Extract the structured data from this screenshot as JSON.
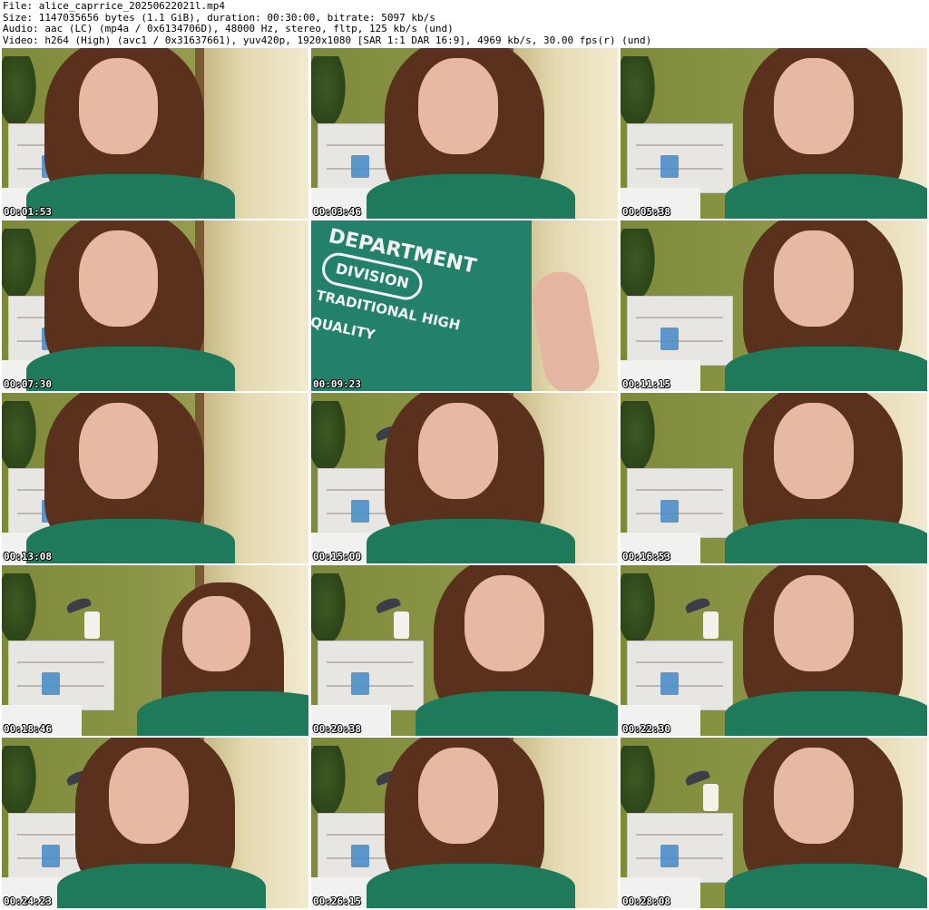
{
  "header": {
    "file": "File: alice_caprrice_20250622021l.mp4",
    "size": "Size: 1147035656 bytes (1.1 GiB), duration: 00:30:00, bitrate: 5097 kb/s",
    "audio": "Audio: aac (LC) (mp4a / 0x6134706D), 48000 Hz, stereo, fltp, 125 kb/s (und)",
    "video": "Video: h264 (High) (avc1 / 0x31637661), yuv420p, 1920x1080 [SAR 1:1 DAR 16:9], 4969 kb/s, 30.00 fps(r) (und)"
  },
  "thumbnails": [
    {
      "time": "00:01:53"
    },
    {
      "time": "00:03:46"
    },
    {
      "time": "00:05:38"
    },
    {
      "time": "00:07:30"
    },
    {
      "time": "00:09:23",
      "shirt_text": [
        "DEPARTMENT",
        "DIVISION",
        "TRADITIONAL HIGH QUALITY"
      ]
    },
    {
      "time": "00:11:15"
    },
    {
      "time": "00:13:08"
    },
    {
      "time": "00:15:00"
    },
    {
      "time": "00:16:53"
    },
    {
      "time": "00:18:46"
    },
    {
      "time": "00:20:38"
    },
    {
      "time": "00:22:30"
    },
    {
      "time": "00:24:23"
    },
    {
      "time": "00:26:15"
    },
    {
      "time": "00:28:08"
    }
  ],
  "colors": {
    "shirt": "#1f7a5b",
    "hair": "#5a311c",
    "wall": "#8a9446",
    "curtain": "#e4d9b0",
    "glass": "#4b8ec9"
  }
}
